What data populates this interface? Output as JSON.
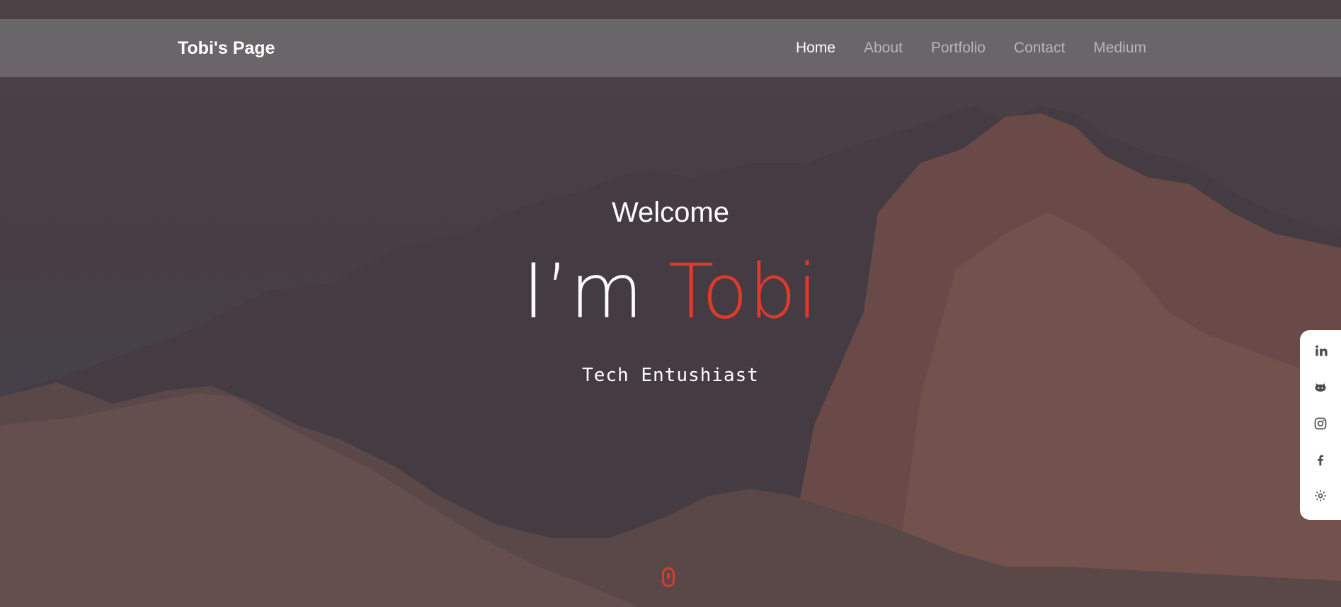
{
  "navbar": {
    "brand": "Tobi's Page",
    "links": [
      {
        "label": "Home",
        "active": true
      },
      {
        "label": "About",
        "active": false
      },
      {
        "label": "Portfolio",
        "active": false
      },
      {
        "label": "Contact",
        "active": false
      },
      {
        "label": "Medium",
        "active": false
      }
    ]
  },
  "hero": {
    "welcome": "Welcome",
    "headline_prefix": "I’m ",
    "headline_name": "Tobi",
    "tagline": "Tech Entushiast"
  },
  "social": {
    "icons": [
      "linkedin-icon",
      "github-icon",
      "instagram-icon",
      "facebook-icon",
      "settings-gear-icon"
    ]
  },
  "colors": {
    "accent": "#e03a2b",
    "navbar_bg": "#6e6c6e",
    "text": "#ffffff"
  }
}
